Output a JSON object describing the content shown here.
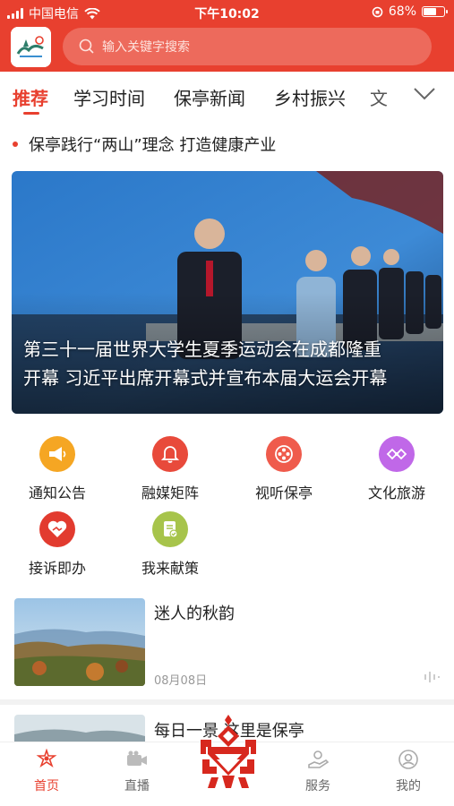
{
  "status_bar": {
    "carrier": "中国电信",
    "time": "下午10:02",
    "battery": "68%",
    "battery_level": 0.68
  },
  "header": {
    "search_placeholder": "输入关键字搜索"
  },
  "tabs": [
    {
      "label": "推荐",
      "active": true
    },
    {
      "label": "学习时间",
      "active": false
    },
    {
      "label": "保亭新闻",
      "active": false
    },
    {
      "label": "乡村振兴",
      "active": false
    },
    {
      "label": "文",
      "active": false
    }
  ],
  "headline": "保亭践行“两山”理念 打造健康产业",
  "hero": {
    "caption_line1": "第三十一届世界大学生夏季运动会在成都隆重",
    "caption_line2": "开幕 习近平出席开幕式并宣布本届大运会开幕"
  },
  "quick_links": [
    {
      "label": "通知公告",
      "icon": "megaphone-icon",
      "color": "#f5a623"
    },
    {
      "label": "融媒矩阵",
      "icon": "bell-icon",
      "color": "#e84a3b"
    },
    {
      "label": "视听保亭",
      "icon": "film-reel-icon",
      "color": "#ef5b4c"
    },
    {
      "label": "文化旅游",
      "icon": "culture-pattern-icon",
      "color": "#c068e8"
    },
    {
      "label": "接诉即办",
      "icon": "heart-handshake-icon",
      "color": "#e23b2f"
    },
    {
      "label": "我来献策",
      "icon": "document-check-icon",
      "color": "#a7c44b"
    }
  ],
  "news": [
    {
      "title": "迷人的秋韵",
      "date": "08月08日"
    },
    {
      "title": "每日一景 这里是保亭",
      "date": ""
    }
  ],
  "bottom_nav": [
    {
      "label": "首页",
      "icon": "home-emblem-icon",
      "active": true
    },
    {
      "label": "直播",
      "icon": "video-camera-icon",
      "active": false
    },
    {
      "label": "服务",
      "icon": "service-icon",
      "active": false
    },
    {
      "label": "我的",
      "icon": "user-icon",
      "active": false
    }
  ],
  "colors": {
    "brand": "#e8402f",
    "text": "#222222",
    "muted": "#999999"
  }
}
